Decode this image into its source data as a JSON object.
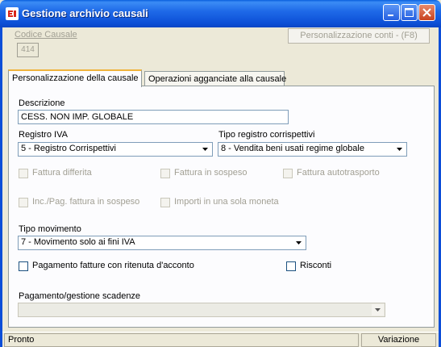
{
  "window": {
    "title": "Gestione archivio causali",
    "titlebar_color": "#0a5fdd",
    "controls": [
      "minimize-icon",
      "maximize-icon",
      "close-icon"
    ]
  },
  "header": {
    "codice_label": "Codice Causale",
    "codice_value": "414",
    "personalizzazione_button": "Personalizzazione conti - (F8)"
  },
  "tabs": [
    {
      "label": "Personalizzazione della causale",
      "active": true
    },
    {
      "label": "Operazioni agganciate alla causale",
      "active": false
    }
  ],
  "form": {
    "descrizione_label": "Descrizione",
    "descrizione_value": "CESS. NON IMP. GLOBALE",
    "registro_iva_label": "Registro IVA",
    "registro_iva_value": "5 - Registro Corrispettivi",
    "tipo_registro_label": "Tipo registro corrispettivi",
    "tipo_registro_value": "8 - Vendita beni usati regime globale",
    "fattura_differita": "Fattura differita",
    "fattura_sospeso": "Fattura in sospeso",
    "fattura_autotrasporto": "Fattura autotrasporto",
    "inc_pag_sospeso": "Inc./Pag. fattura in sospeso",
    "importi_moneta": "Importi in una sola moneta",
    "tipo_movimento_label": "Tipo movimento",
    "tipo_movimento_value": "7 - Movimento solo ai fini IVA",
    "pagamento_ritenuta": "Pagamento fatture con ritenuta d'acconto",
    "risconti": "Risconti",
    "pagamento_scadenze_label": "Pagamento/gestione scadenze",
    "pagamento_scadenze_value": ""
  },
  "status": {
    "left": "Pronto",
    "right": "Variazione"
  }
}
